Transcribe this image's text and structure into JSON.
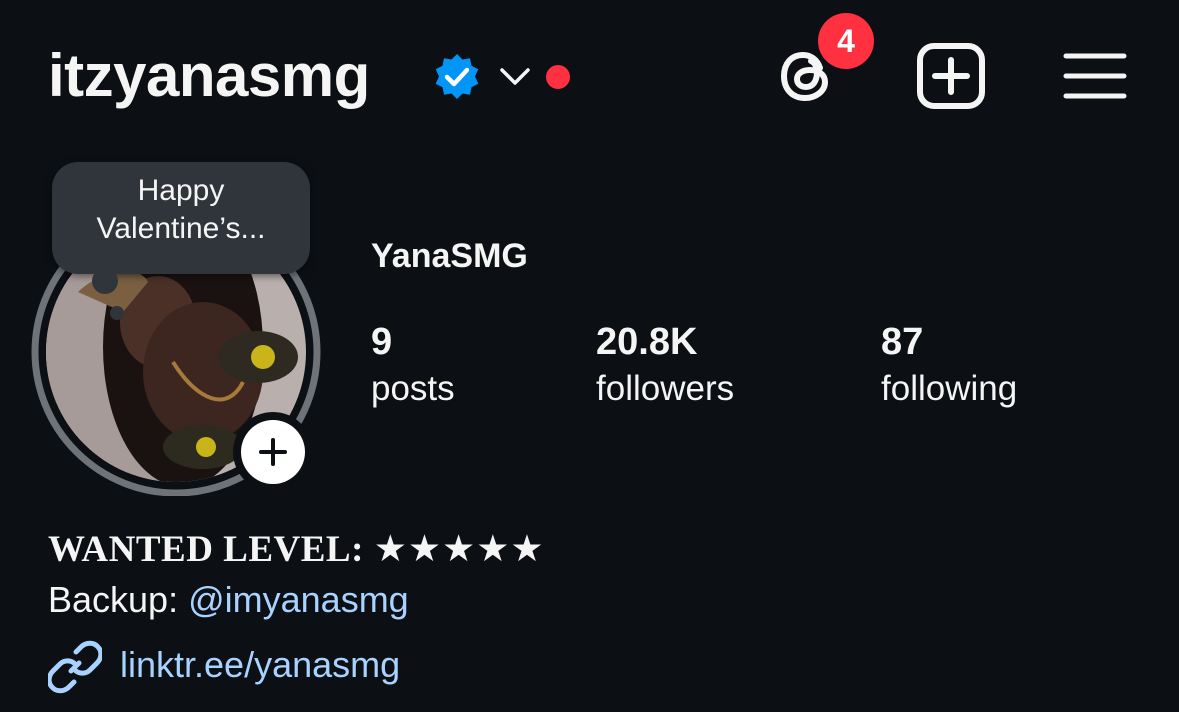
{
  "header": {
    "username": "itzyanasmg",
    "verified_icon": "verified-badge-icon",
    "chevron_icon": "chevron-down-icon",
    "threads_icon": "threads-icon",
    "threads_badge_count": "4",
    "new_post_icon": "plus-square-icon",
    "menu_icon": "hamburger-menu-icon"
  },
  "note": {
    "line1": "Happy",
    "line2": "Valentine’s..."
  },
  "profile": {
    "display_name": "YanaSMG",
    "add_story_icon": "plus-icon",
    "stats": [
      {
        "value": "9",
        "label": "posts"
      },
      {
        "value": "20.8K",
        "label": "followers"
      },
      {
        "value": "87",
        "label": "following"
      }
    ]
  },
  "bio": {
    "wanted_label": "WANTED LEVEL:",
    "wanted_stars": "★★★★★",
    "backup_label": "Backup:",
    "backup_mention": "@imyanasmg",
    "link_icon": "link-icon",
    "link_text": "linktr.ee/yanasmg"
  },
  "colors": {
    "background": "#0c1014",
    "verified_blue": "#0095f6",
    "notification_red": "#ff3040",
    "link_blue": "#a8d2ff",
    "note_bubble": "#30353b",
    "story_ring": "#6e7379"
  }
}
